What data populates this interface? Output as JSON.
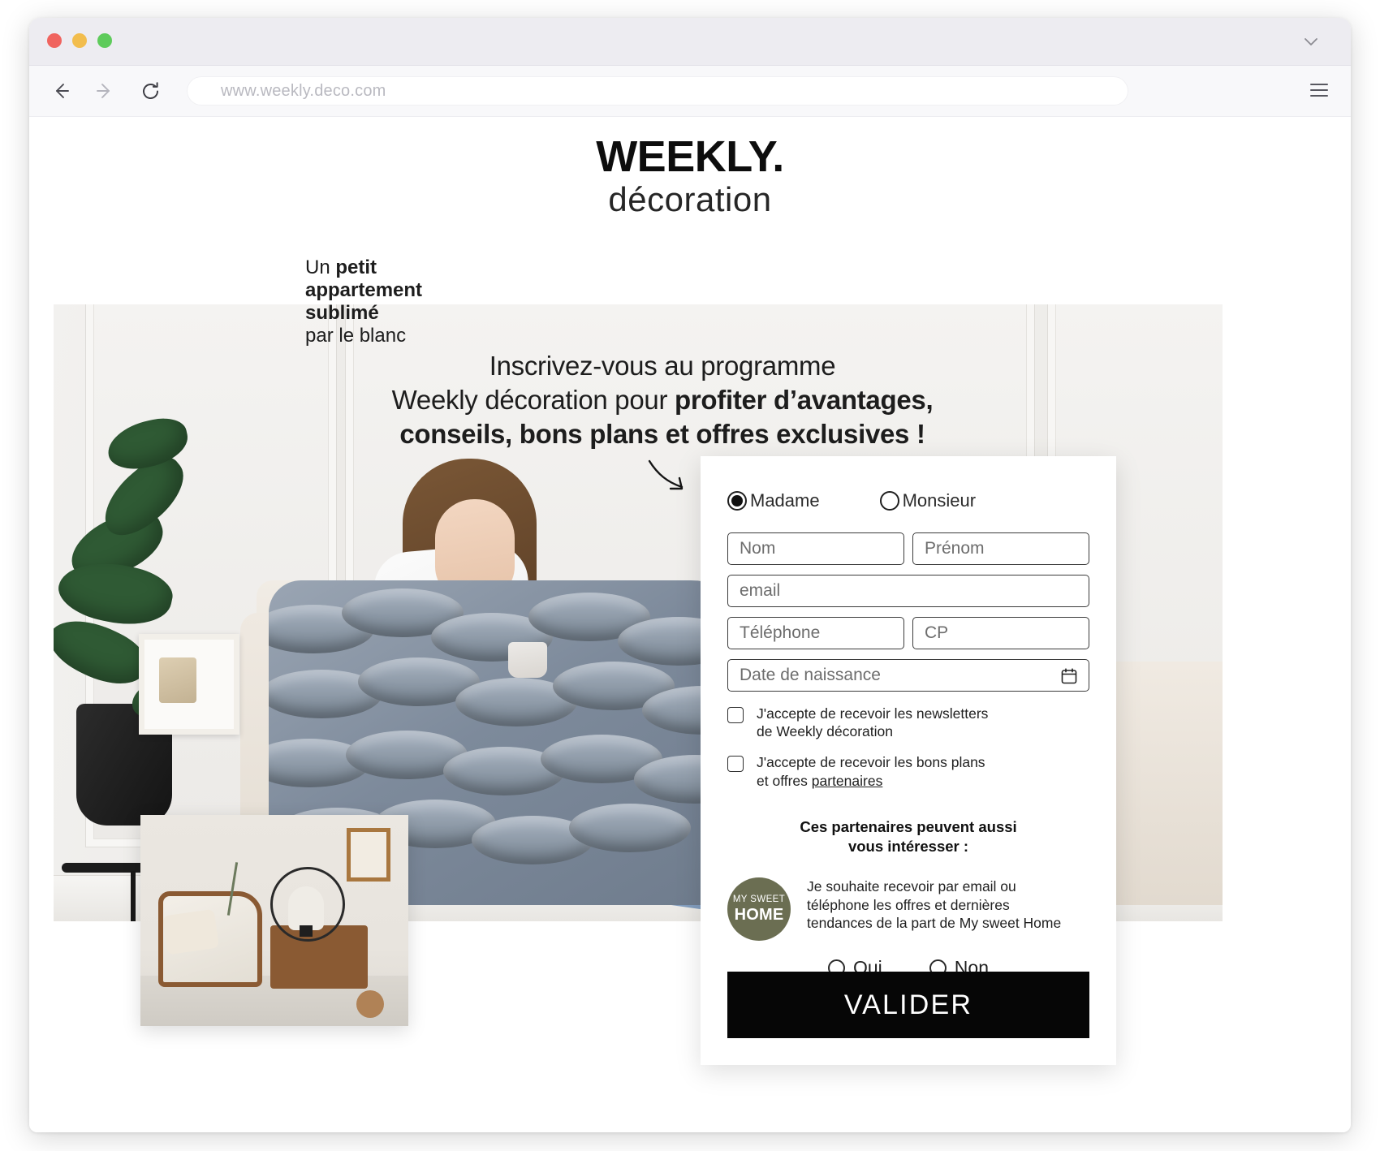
{
  "browser": {
    "url": "www.weekly.deco.com",
    "back_icon": "arrow-left-icon",
    "forward_icon": "arrow-right-icon",
    "reload_icon": "reload-icon",
    "menu_icon": "hamburger-menu-icon",
    "expand_icon": "chevron-down-icon"
  },
  "logo": {
    "main": "WEEKLY.",
    "sub": "décoration"
  },
  "hero": {
    "headline_line1": "Inscrivez-vous au programme",
    "headline_line2_normal": "Weekly décoration pour ",
    "headline_line2_bold": "profiter d’avantages,",
    "headline_line3_bold": "conseils, bons plans et offres exclusives !"
  },
  "card": {
    "caption_1_normal": "Un ",
    "caption_1_bold": "petit",
    "caption_2_bold": "appartement",
    "caption_3_bold": "sublimé",
    "caption_4_normal": "par le blanc"
  },
  "form": {
    "civility": {
      "madame": "Madame",
      "monsieur": "Monsieur",
      "selected": "Madame"
    },
    "fields": {
      "nom": "Nom",
      "prenom": "Prénom",
      "email": "email",
      "telephone": "Téléphone",
      "cp": "CP",
      "date": "Date de naissance",
      "date_icon": "calendar-icon"
    },
    "consents": [
      {
        "line1": "J'accepte de recevoir les newsletters",
        "line2": "de Weekly décoration",
        "link": "",
        "checked": false
      },
      {
        "line1": "J'accepte de recevoir les bons plans",
        "line2": "et offres ",
        "link": "partenaires",
        "checked": false
      }
    ],
    "partners_title_line1": "Ces partenaires peuvent aussi",
    "partners_title_line2": "vous intéresser :",
    "partner": {
      "logo_line1": "MY SWEET",
      "logo_line2": "HOME",
      "logo_color": "#6b6e52",
      "text_line1": "Je souhaite recevoir par email ou",
      "text_line2": "téléphone les offres et dernières",
      "text_line3": "tendances de la part de My sweet Home",
      "option_yes": "Oui",
      "option_no": "Non",
      "selected": ""
    },
    "submit_label": "VALIDER",
    "submit_color": "#060606"
  }
}
